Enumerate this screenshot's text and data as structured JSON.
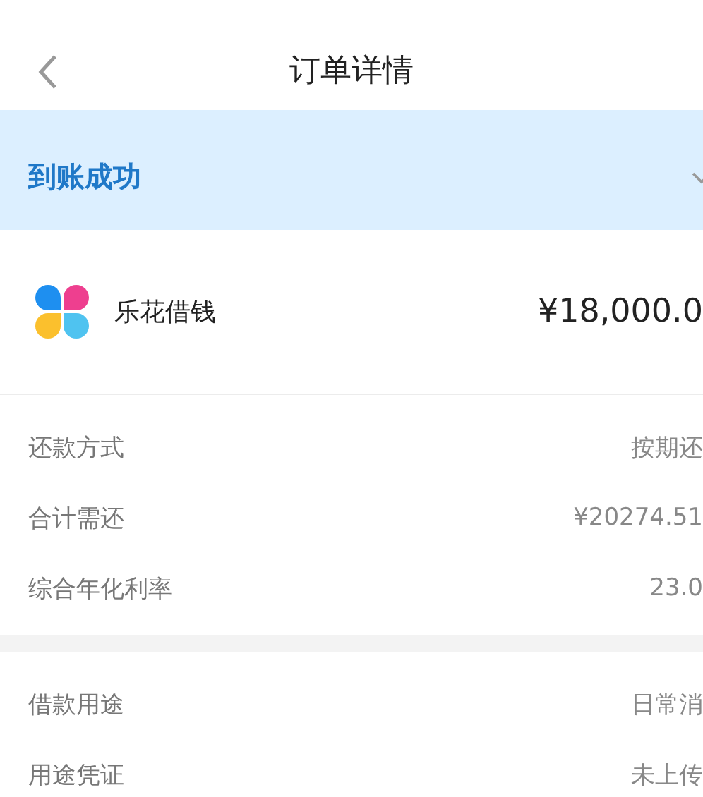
{
  "nav": {
    "title": "订单详情"
  },
  "banner": {
    "status": "到账成功"
  },
  "loan": {
    "product": "乐花借钱",
    "amount": "¥18,000.0"
  },
  "sections": [
    {
      "rows": [
        {
          "label": "还款方式",
          "value": "按期还"
        },
        {
          "label": "合计需还",
          "value": "¥20274.51"
        },
        {
          "label": "综合年化利率",
          "value": "23.0"
        }
      ]
    },
    {
      "rows": [
        {
          "label": "借款用途",
          "value": "日常消"
        },
        {
          "label": "用途凭证",
          "value": "未上传"
        }
      ]
    }
  ]
}
